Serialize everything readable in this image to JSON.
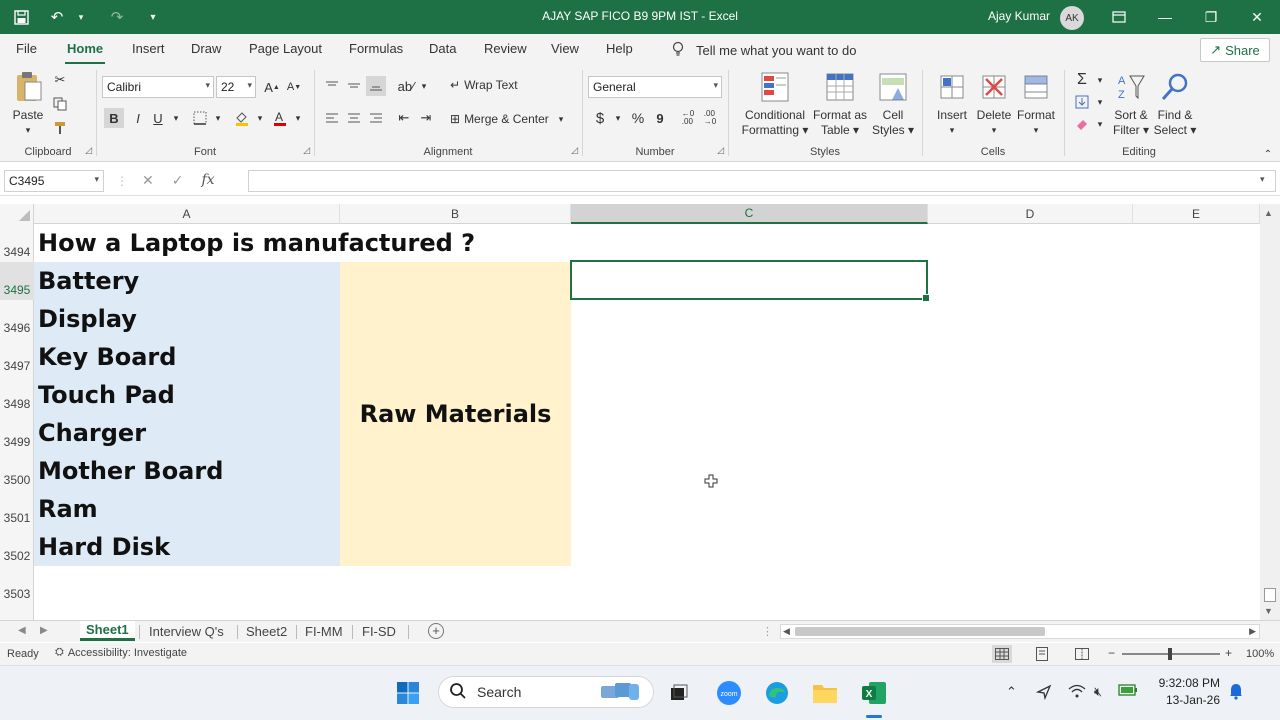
{
  "titlebar": {
    "title": "AJAY SAP FICO B9 9PM IST  -  Excel",
    "user": "Ajay Kumar",
    "avatar_initials": "AK",
    "brand_color": "#1e7145"
  },
  "tabs": [
    "File",
    "Home",
    "Insert",
    "Draw",
    "Page Layout",
    "Formulas",
    "Data",
    "Review",
    "View",
    "Help"
  ],
  "active_tab": "Home",
  "tellme": "Tell me what you want to do",
  "share": "Share",
  "ribbon": {
    "clipboard": {
      "paste": "Paste",
      "label": "Clipboard"
    },
    "font": {
      "name": "Calibri",
      "size": "22",
      "bold": "B",
      "italic": "I",
      "underline": "U",
      "label": "Font"
    },
    "alignment": {
      "wrap": "Wrap Text",
      "merge": "Merge & Center",
      "label": "Alignment"
    },
    "number": {
      "format": "General",
      "currency": "$",
      "percent": "%",
      "comma": "9",
      "label": "Number"
    },
    "styles": {
      "conditional": "Conditional",
      "conditional2": "Formatting",
      "table": "Format as",
      "table2": "Table",
      "cell": "Cell",
      "cell2": "Styles",
      "label": "Styles"
    },
    "cells": {
      "insert": "Insert",
      "delete": "Delete",
      "format": "Format",
      "label": "Cells"
    },
    "editing": {
      "sort": "Sort &",
      "sort2": "Filter",
      "find": "Find &",
      "find2": "Select",
      "label": "Editing"
    }
  },
  "formula_bar": {
    "namebox": "C3495",
    "fx": "fx",
    "value": ""
  },
  "columns": [
    "A",
    "B",
    "C",
    "D",
    "E"
  ],
  "selected_column": "C",
  "rows": [
    "3494",
    "3495",
    "3496",
    "3497",
    "3498",
    "3499",
    "3500",
    "3501",
    "3502",
    "3503"
  ],
  "selected_row": "3495",
  "cells": {
    "title": "How a Laptop is manufactured ?",
    "components": [
      "Battery",
      "Display",
      "Key Board",
      "Touch Pad",
      "Charger",
      "Mother Board",
      "Ram",
      "Hard Disk"
    ],
    "merged_label": "Raw Materials"
  },
  "sheets": [
    "Sheet1",
    "Interview Q's",
    "Sheet2",
    "FI-MM",
    "FI-SD"
  ],
  "active_sheet": "Sheet1",
  "status": {
    "ready": "Ready",
    "accessibility": "Accessibility: Investigate",
    "zoom": "100%"
  },
  "taskbar": {
    "search": "Search",
    "time": "9:32:08 PM",
    "date": "13-Jan-26",
    "zoom_app": "zoom"
  }
}
